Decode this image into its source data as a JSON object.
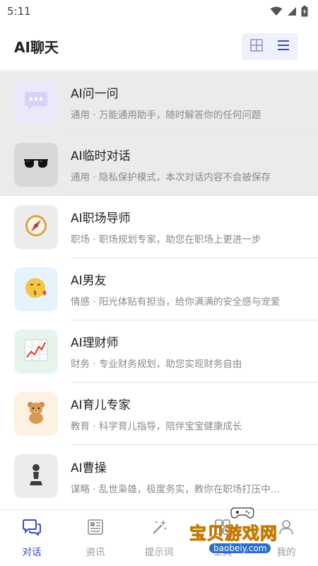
{
  "status_bar": {
    "time": "5:11"
  },
  "header": {
    "title": "AI聊天"
  },
  "chats": [
    {
      "name": "AI问一问",
      "desc": "通用 · 万能通用助手，随时解答你的任何问题",
      "avatar_bg": "#ece8fb",
      "highlight": true
    },
    {
      "name": "AI临时对话",
      "desc": "通用 · 隐私保护模式，本次对话内容不会被保存",
      "avatar_bg": "#d8d8d8",
      "highlight": true
    },
    {
      "name": "AI职场导师",
      "desc": "职场 · 职场规划专家，助您在职场上更进一步",
      "avatar_bg": "#ececec",
      "highlight": false
    },
    {
      "name": "AI男友",
      "desc": "情感 · 阳光体贴有担当，给你满满的安全感与宠爱",
      "avatar_bg": "#e6f3fc",
      "highlight": false
    },
    {
      "name": "AI理财师",
      "desc": "财务 · 专业财务规划，助您实现财务自由",
      "avatar_bg": "#e5f5ec",
      "highlight": false
    },
    {
      "name": "AI育儿专家",
      "desc": "教育 · 科学育儿指导，陪伴宝宝健康成长",
      "avatar_bg": "#fdf1e2",
      "highlight": false
    },
    {
      "name": "AI曹操",
      "desc": "谋略 · 乱世枭雄，极度务实，教你在职场打压中...",
      "avatar_bg": "#ececec",
      "highlight": false
    }
  ],
  "tabs": [
    {
      "label": "对话",
      "icon": "chat-icon",
      "active": true
    },
    {
      "label": "资讯",
      "icon": "news-icon",
      "active": false
    },
    {
      "label": "提示词",
      "icon": "magic-wand-icon",
      "active": false
    },
    {
      "label": "工具",
      "icon": "tools-icon",
      "active": false
    },
    {
      "label": "我的",
      "icon": "profile-icon",
      "active": false
    }
  ],
  "watermark": {
    "brand": "宝贝游戏网",
    "url": "baobeiy.com"
  },
  "colors": {
    "accent": "#3d4bbf",
    "highlight": "#ebebeb"
  }
}
